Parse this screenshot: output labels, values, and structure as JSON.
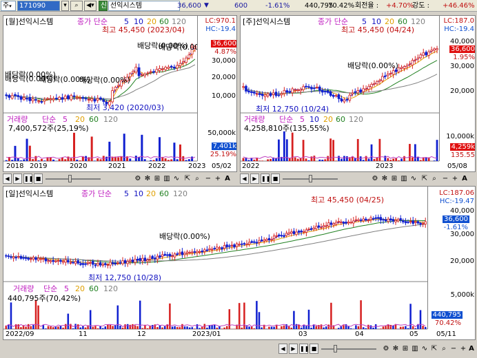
{
  "toolbar": {
    "market": "주",
    "code": "171090",
    "shin": "신",
    "name": "선익시스템",
    "price": "36,600",
    "down_arrow": "▼",
    "change": "600",
    "change_pct": "-1.61%",
    "volume": "440,795",
    "volume_pct": "70.42%",
    "turnover_label": "회전율 :",
    "turnover_val": "+4.70%",
    "strength_label": "강도 :",
    "strength_val": "+46.46%"
  },
  "monthly": {
    "title": "[월]선익시스템",
    "ma_label": "종가 단순",
    "ma_periods": [
      "5",
      "10",
      "20",
      "60",
      "120"
    ],
    "lc": "LC:970.1",
    "hc": "HC:-19.4",
    "high_ann": "최고 45,450 (2023/04)",
    "low_ann": "최저 3,420 (2020/03)",
    "div_anns": [
      "배당락(0.00%)",
      "배당락(0.00%)",
      "배당락(0.00%)",
      "배당락(0.00%)",
      "배당락(0.00%)",
      "배당락(0.00%)"
    ],
    "price_tag": "36,600",
    "pct_tag": "4.87%",
    "yticks": [
      "30,000",
      "20,000",
      "10,000"
    ],
    "vol_title": "거래량",
    "vol_ma_label": "단순",
    "vol_periods": [
      "5",
      "20",
      "60",
      "120"
    ],
    "vol_value": "7,400,572주(25,19%)",
    "vol_yticks": [
      "50,000k"
    ],
    "vol_tag": "7,401k",
    "vol_pct_tag": "25.19%",
    "xticks": [
      "2018",
      "2019",
      "2020",
      "2021",
      "2022",
      "2023",
      "05/02"
    ]
  },
  "weekly": {
    "title": "[주]선익시스템",
    "ma_label": "종가 단순",
    "ma_periods": [
      "5",
      "10",
      "20",
      "60",
      "120"
    ],
    "lc": "LC:187.0",
    "hc": "HC:-19.4",
    "high_ann": "최고 45,450 (04/24)",
    "low_ann": "최저 12,750 (10/24)",
    "div_ann": "배당락(0.00%)",
    "price_tag": "36,600",
    "pct_tag": "1.95%",
    "yticks": [
      "40,000",
      "30,000",
      "20,000"
    ],
    "vol_title": "거래량",
    "vol_ma_label": "단순",
    "vol_periods": [
      "5",
      "10",
      "20",
      "60",
      "120"
    ],
    "vol_value": "4,258,810주(135,55%)",
    "vol_yticks": [
      "10,000k",
      "5,000k"
    ],
    "vol_tag": "4,259k",
    "vol_pct_tag": "135.55",
    "xticks": [
      "2022",
      "2023",
      "05/08"
    ]
  },
  "daily": {
    "title": "[일]선익시스템",
    "ma_label": "종가 단순",
    "ma_periods": [
      "5",
      "10",
      "20",
      "60",
      "120"
    ],
    "lc": "LC:187.06",
    "hc": "HC:-19.47",
    "high_ann": "최고 45,450 (04/25)",
    "low_ann": "최저 12,750 (10/28)",
    "div_ann": "배당락(0.00%)",
    "price_tag": "36,600",
    "pct_tag": "-1.61%",
    "yticks": [
      "40,000",
      "30,000",
      "20,000"
    ],
    "vol_title": "거래량",
    "vol_ma_label": "단순",
    "vol_periods": [
      "5",
      "20",
      "60",
      "120"
    ],
    "vol_value": "440,795주(70,42%)",
    "vol_yticks": [
      "5,000k"
    ],
    "vol_tag": "440,795",
    "vol_pct_tag": "70.42%",
    "xticks": [
      "2022/09",
      "11",
      "12",
      "2023/01",
      "03",
      "04",
      "05",
      "05/11"
    ]
  },
  "colors": {
    "up": "#d62020",
    "down": "#1020d0",
    "ma5": "#1010c0",
    "ma20": "#e0a000",
    "ma60": "#208020",
    "ma120": "#808080",
    "vol_ma5": "#c040c0",
    "vol_ma20": "#e0a000",
    "tag_red": "#e01010",
    "tag_blue": "#1050d0"
  }
}
